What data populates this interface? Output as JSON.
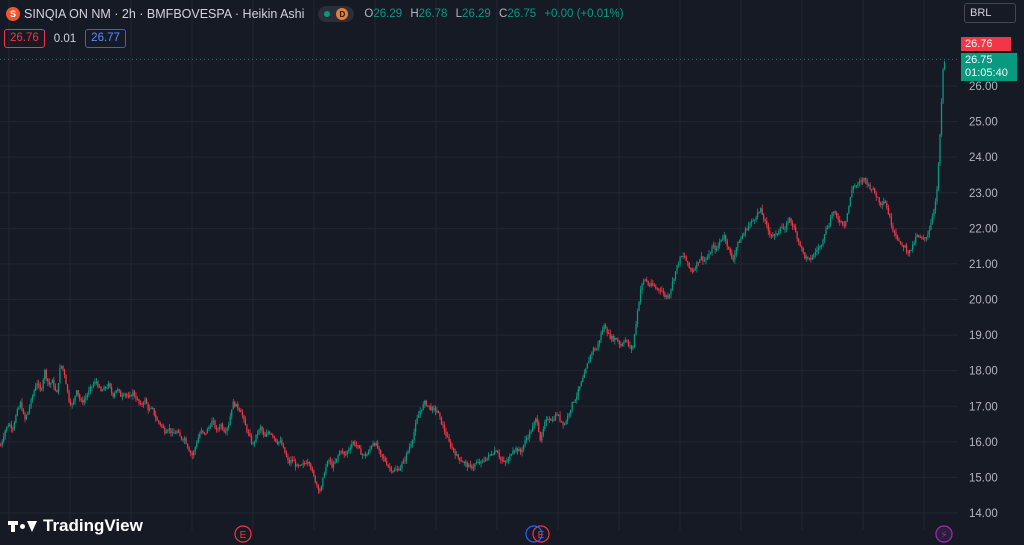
{
  "legend": {
    "logo_letter": "S",
    "title": "SINQIA ON NM · 2h · BMFBOVESPA · Heikin Ashi",
    "status_logo_letter": "D",
    "open_label": "O",
    "open": "26.29",
    "high_label": "H",
    "high": "26.78",
    "low_label": "L",
    "low": "26.29",
    "close_label": "C",
    "close": "26.75",
    "change": "+0.00 (+0.01%)"
  },
  "trade": {
    "sell": "26.76",
    "spread": "0.01",
    "buy": "26.77"
  },
  "currency": "BRL",
  "price_tags": {
    "ask": "26.76",
    "last": "26.75",
    "countdown": "01:05:40"
  },
  "brand": "TradingView",
  "colors": {
    "up": "#089981",
    "down": "#f23645",
    "background": "#161a25",
    "grid": "#232632",
    "text": "#d1d4dc",
    "earnings": "#f23645",
    "events": "#9c27b0"
  },
  "chart_data": {
    "type": "candlestick",
    "style": "Heikin Ashi",
    "symbol": "SINQIA ON NM",
    "interval": "2h",
    "exchange": "BMFBOVESPA",
    "currency": "BRL",
    "y_ticks": [
      "14.00",
      "15.00",
      "16.00",
      "17.00",
      "18.00",
      "19.00",
      "20.00",
      "21.00",
      "22.00",
      "23.00",
      "24.00",
      "25.00",
      "26.00"
    ],
    "ylim": [
      13.5,
      27.1
    ],
    "grid": true,
    "path_points": [
      [
        0,
        15.9
      ],
      [
        4,
        16.3
      ],
      [
        8,
        16.5
      ],
      [
        12,
        16.4
      ],
      [
        16,
        16.8
      ],
      [
        20,
        17.1
      ],
      [
        24,
        16.6
      ],
      [
        28,
        16.9
      ],
      [
        32,
        17.3
      ],
      [
        36,
        17.7
      ],
      [
        40,
        17.4
      ],
      [
        44,
        18
      ],
      [
        48,
        17.6
      ],
      [
        52,
        17.7
      ],
      [
        56,
        17.3
      ],
      [
        60,
        18.2
      ],
      [
        64,
        17.9
      ],
      [
        68,
        17.2
      ],
      [
        72,
        17
      ],
      [
        76,
        17.5
      ],
      [
        80,
        17.1
      ],
      [
        84,
        17.2
      ],
      [
        88,
        17.4
      ],
      [
        92,
        17.6
      ],
      [
        96,
        17.7
      ],
      [
        100,
        17.4
      ],
      [
        104,
        17.5
      ],
      [
        108,
        17.6
      ],
      [
        112,
        17.3
      ],
      [
        116,
        17.5
      ],
      [
        120,
        17.3
      ],
      [
        124,
        17.4
      ],
      [
        128,
        17.2
      ],
      [
        132,
        17.4
      ],
      [
        136,
        17.2
      ],
      [
        140,
        17
      ],
      [
        144,
        17.2
      ],
      [
        148,
        16.9
      ],
      [
        152,
        16.9
      ],
      [
        156,
        16.6
      ],
      [
        160,
        16.5
      ],
      [
        164,
        16.3
      ],
      [
        168,
        16.4
      ],
      [
        172,
        16.2
      ],
      [
        176,
        16.3
      ],
      [
        180,
        16.1
      ],
      [
        184,
        16.1
      ],
      [
        188,
        15.8
      ],
      [
        192,
        15.6
      ],
      [
        196,
        16
      ],
      [
        200,
        16.3
      ],
      [
        204,
        16.2
      ],
      [
        208,
        16.4
      ],
      [
        212,
        16.6
      ],
      [
        216,
        16.3
      ],
      [
        220,
        16.5
      ],
      [
        224,
        16.3
      ],
      [
        228,
        16.5
      ],
      [
        232,
        17.1
      ],
      [
        236,
        17
      ],
      [
        240,
        16.9
      ],
      [
        244,
        16.5
      ],
      [
        248,
        16.2
      ],
      [
        252,
        15.9
      ],
      [
        256,
        16.2
      ],
      [
        260,
        16.4
      ],
      [
        264,
        16.1
      ],
      [
        268,
        16.3
      ],
      [
        272,
        16.2
      ],
      [
        276,
        16
      ],
      [
        280,
        16
      ],
      [
        284,
        15.7
      ],
      [
        288,
        15.4
      ],
      [
        292,
        15.5
      ],
      [
        296,
        15.3
      ],
      [
        300,
        15.3
      ],
      [
        304,
        15.4
      ],
      [
        308,
        15.5
      ],
      [
        312,
        15.1
      ],
      [
        316,
        14.8
      ],
      [
        320,
        14.6
      ],
      [
        324,
        15.2
      ],
      [
        328,
        15.5
      ],
      [
        332,
        15.3
      ],
      [
        336,
        15.5
      ],
      [
        340,
        15.8
      ],
      [
        344,
        15.6
      ],
      [
        348,
        15.8
      ],
      [
        352,
        16
      ],
      [
        356,
        15.9
      ],
      [
        360,
        15.7
      ],
      [
        364,
        15.6
      ],
      [
        368,
        15.7
      ],
      [
        372,
        16
      ],
      [
        376,
        15.9
      ],
      [
        380,
        15.6
      ],
      [
        384,
        15.5
      ],
      [
        388,
        15.3
      ],
      [
        392,
        15.2
      ],
      [
        396,
        15.2
      ],
      [
        400,
        15.3
      ],
      [
        404,
        15.5
      ],
      [
        408,
        15.8
      ],
      [
        412,
        16.1
      ],
      [
        416,
        16.6
      ],
      [
        420,
        16.9
      ],
      [
        424,
        17.1
      ],
      [
        428,
        17
      ],
      [
        432,
        16.9
      ],
      [
        436,
        16.9
      ],
      [
        440,
        16.6
      ],
      [
        444,
        16.3
      ],
      [
        448,
        16
      ],
      [
        452,
        15.8
      ],
      [
        456,
        15.6
      ],
      [
        460,
        15.5
      ],
      [
        464,
        15.4
      ],
      [
        468,
        15.3
      ],
      [
        472,
        15.3
      ],
      [
        476,
        15.4
      ],
      [
        480,
        15.4
      ],
      [
        484,
        15.5
      ],
      [
        488,
        15.6
      ],
      [
        492,
        15.7
      ],
      [
        496,
        15.8
      ],
      [
        500,
        15.5
      ],
      [
        504,
        15.4
      ],
      [
        508,
        15.5
      ],
      [
        512,
        15.8
      ],
      [
        516,
        15.8
      ],
      [
        520,
        15.7
      ],
      [
        524,
        16
      ],
      [
        528,
        16.2
      ],
      [
        532,
        16.4
      ],
      [
        536,
        16.7
      ],
      [
        540,
        16
      ],
      [
        544,
        16.5
      ],
      [
        548,
        16.7
      ],
      [
        552,
        16.6
      ],
      [
        556,
        16.8
      ],
      [
        560,
        16.6
      ],
      [
        564,
        16.5
      ],
      [
        568,
        16.8
      ],
      [
        572,
        17.1
      ],
      [
        576,
        17.3
      ],
      [
        580,
        17.6
      ],
      [
        584,
        17.9
      ],
      [
        588,
        18.3
      ],
      [
        592,
        18.6
      ],
      [
        596,
        18.6
      ],
      [
        600,
        19
      ],
      [
        604,
        19.3
      ],
      [
        608,
        19
      ],
      [
        612,
        18.9
      ],
      [
        616,
        18.9
      ],
      [
        620,
        18.7
      ],
      [
        624,
        18.9
      ],
      [
        628,
        18.7
      ],
      [
        632,
        18.6
      ],
      [
        636,
        19.5
      ],
      [
        640,
        20.3
      ],
      [
        644,
        20.6
      ],
      [
        648,
        20.4
      ],
      [
        652,
        20.4
      ],
      [
        656,
        20.3
      ],
      [
        660,
        20.3
      ],
      [
        664,
        20.1
      ],
      [
        668,
        20.1
      ],
      [
        672,
        20.5
      ],
      [
        676,
        20.9
      ],
      [
        680,
        21.2
      ],
      [
        684,
        21.2
      ],
      [
        688,
        20.9
      ],
      [
        692,
        20.8
      ],
      [
        696,
        21
      ],
      [
        700,
        21.2
      ],
      [
        704,
        21.1
      ],
      [
        708,
        21.2
      ],
      [
        712,
        21.5
      ],
      [
        716,
        21.4
      ],
      [
        720,
        21.7
      ],
      [
        724,
        21.8
      ],
      [
        728,
        21.4
      ],
      [
        732,
        21.1
      ],
      [
        736,
        21.5
      ],
      [
        740,
        21.7
      ],
      [
        744,
        21.9
      ],
      [
        748,
        22.1
      ],
      [
        752,
        22.2
      ],
      [
        756,
        22.4
      ],
      [
        760,
        22.5
      ],
      [
        764,
        22.2
      ],
      [
        768,
        21.9
      ],
      [
        772,
        21.8
      ],
      [
        776,
        21.8
      ],
      [
        780,
        22.1
      ],
      [
        784,
        21.9
      ],
      [
        788,
        22.3
      ],
      [
        792,
        22.1
      ],
      [
        796,
        21.8
      ],
      [
        800,
        21.5
      ],
      [
        804,
        21.2
      ],
      [
        808,
        21.1
      ],
      [
        812,
        21.2
      ],
      [
        816,
        21.4
      ],
      [
        820,
        21.5
      ],
      [
        824,
        21.9
      ],
      [
        828,
        22.1
      ],
      [
        832,
        22.5
      ],
      [
        836,
        22.3
      ],
      [
        840,
        22.2
      ],
      [
        844,
        22.1
      ],
      [
        848,
        22.6
      ],
      [
        852,
        23.2
      ],
      [
        856,
        23.2
      ],
      [
        860,
        23.3
      ],
      [
        864,
        23.4
      ],
      [
        868,
        23.2
      ],
      [
        872,
        23.1
      ],
      [
        876,
        22.9
      ],
      [
        880,
        22.7
      ],
      [
        884,
        22.8
      ],
      [
        888,
        22.4
      ],
      [
        892,
        22
      ],
      [
        896,
        21.8
      ],
      [
        900,
        21.5
      ],
      [
        904,
        21.5
      ],
      [
        908,
        21.3
      ],
      [
        912,
        21.5
      ],
      [
        916,
        21.8
      ],
      [
        920,
        21.7
      ],
      [
        924,
        21.7
      ],
      [
        928,
        21.9
      ],
      [
        932,
        22.4
      ],
      [
        936,
        22.9
      ],
      [
        940,
        24.9
      ],
      [
        942,
        26.4
      ],
      [
        945,
        26.75
      ]
    ],
    "last": 26.75,
    "events": [
      "E",
      "E",
      "E",
      "lightning"
    ]
  }
}
